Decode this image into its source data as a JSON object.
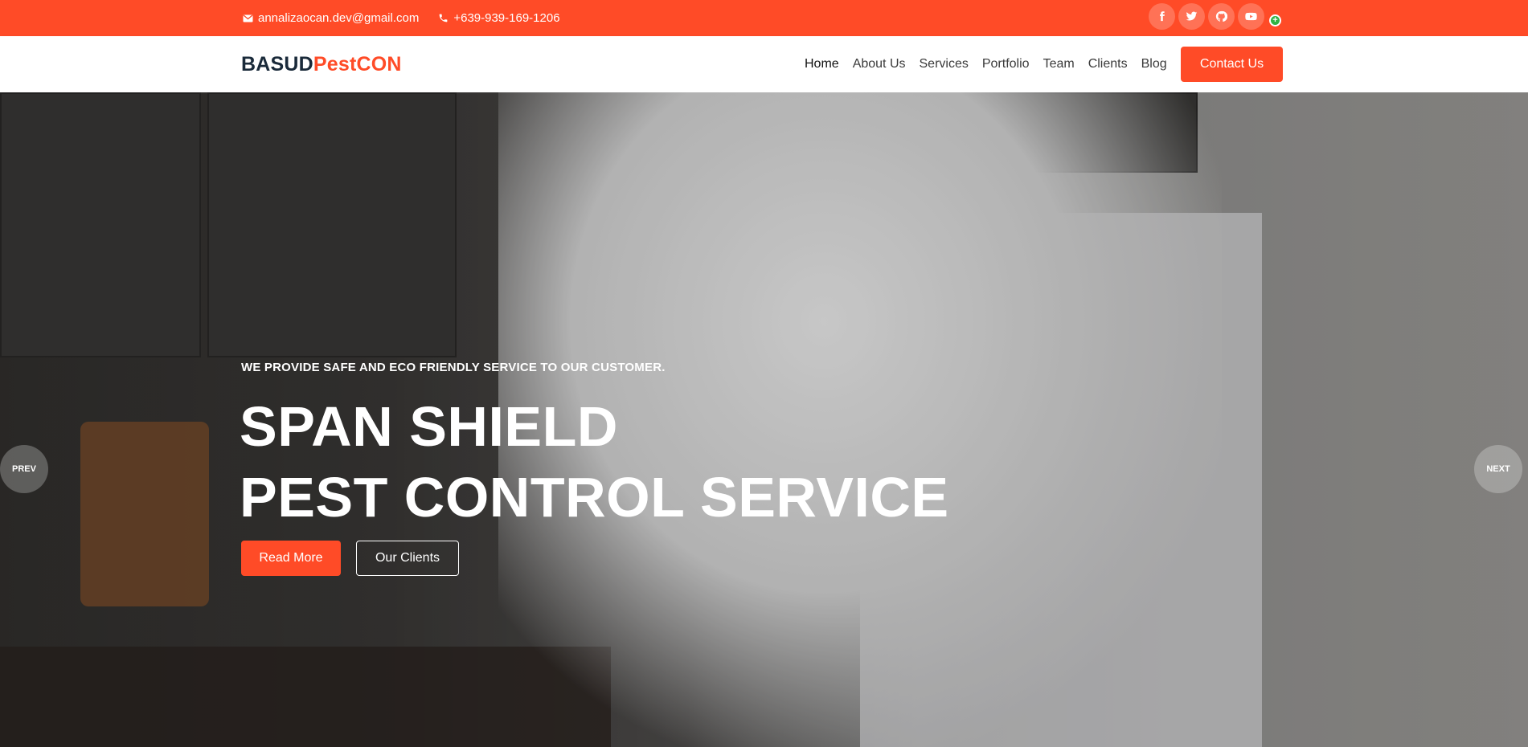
{
  "topbar": {
    "email": "annalizaocan.dev@gmail.com",
    "phone": "+639-939-169-1206",
    "social_icons": [
      "facebook-icon",
      "twitter-icon",
      "github-icon",
      "youtube-icon"
    ],
    "plus_icon": "+"
  },
  "header": {
    "logo_part1": "BASUD",
    "logo_part2": "PestCON",
    "nav": [
      "Home",
      "About Us",
      "Services",
      "Portfolio",
      "Team",
      "Clients",
      "Blog"
    ],
    "cta": "Contact Us"
  },
  "hero": {
    "tagline": "WE PROVIDE SAFE AND ECO FRIENDLY SERVICE TO OUR CUSTOMER.",
    "title_line1": "SPAN SHIELD",
    "title_line2": "PEST CONTROL SERVICE",
    "btn_primary": "Read More",
    "btn_secondary": "Our Clients",
    "prev": "PREV",
    "next": "NEXT"
  },
  "colors": {
    "accent": "#ff4b27",
    "logo_dark": "#1a2a3a"
  }
}
